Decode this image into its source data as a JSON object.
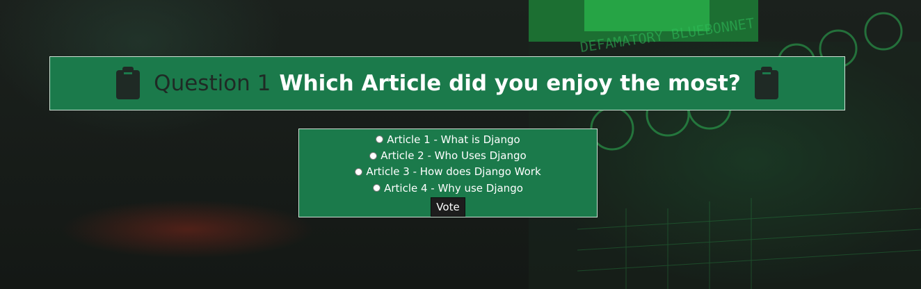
{
  "question": {
    "number_label": "Question 1",
    "text": "Which Article did you enjoy the most?",
    "icon": "clipboard-icon"
  },
  "background": {
    "screen_text": "DEFAMATORY BLUEBONNET"
  },
  "choices": [
    {
      "label": "Article 1 - What is Django"
    },
    {
      "label": "Article 2 - Who Uses Django"
    },
    {
      "label": "Article 3 - How does Django Work"
    },
    {
      "label": "Article 4 - Why use Django"
    }
  ],
  "vote_button": {
    "label": "Vote"
  },
  "colors": {
    "panel": "#1b7a4b",
    "panel_border": "#cfe3d6",
    "question_number": "#1f2a25",
    "button": "#1d1d1d"
  }
}
